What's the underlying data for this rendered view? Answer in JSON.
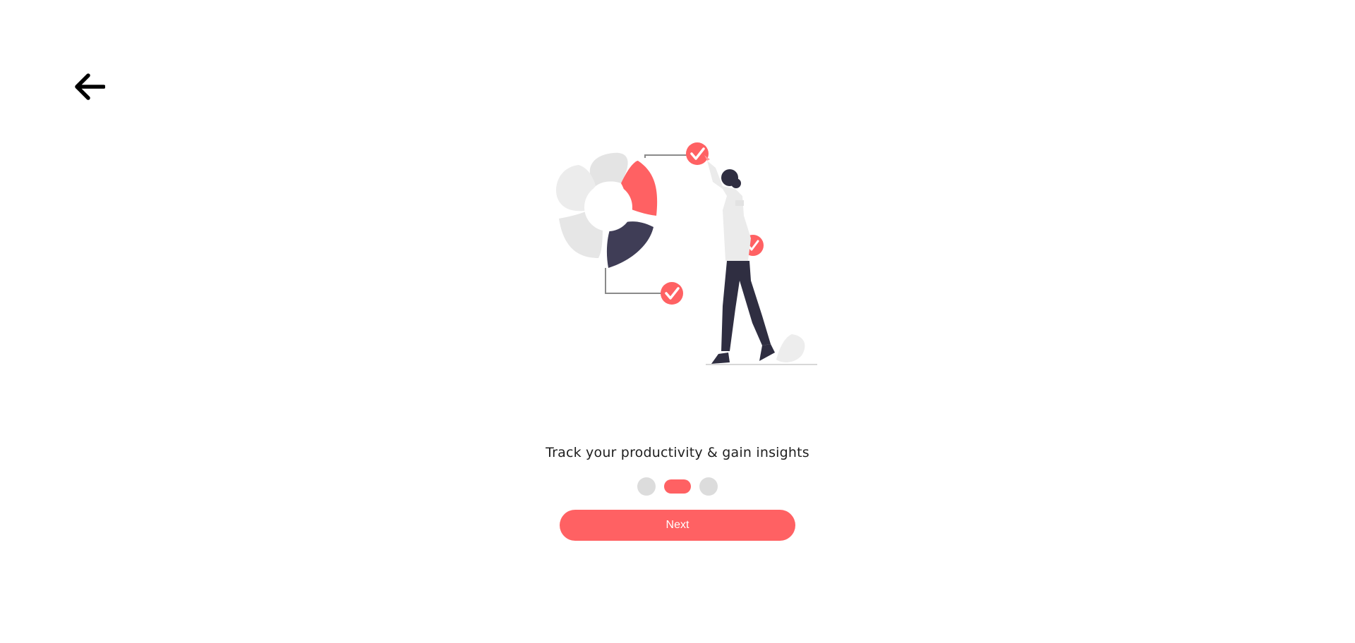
{
  "icons": {
    "back": "arrow-left-icon"
  },
  "onboarding": {
    "headline": "Track your productivity & gain insights",
    "pagination": {
      "total": 3,
      "active_index": 1
    },
    "next_label": "Next"
  },
  "colors": {
    "accent": "#ff6163",
    "dark": "#3f3d56",
    "inactive_dot": "#dcdcdc"
  }
}
